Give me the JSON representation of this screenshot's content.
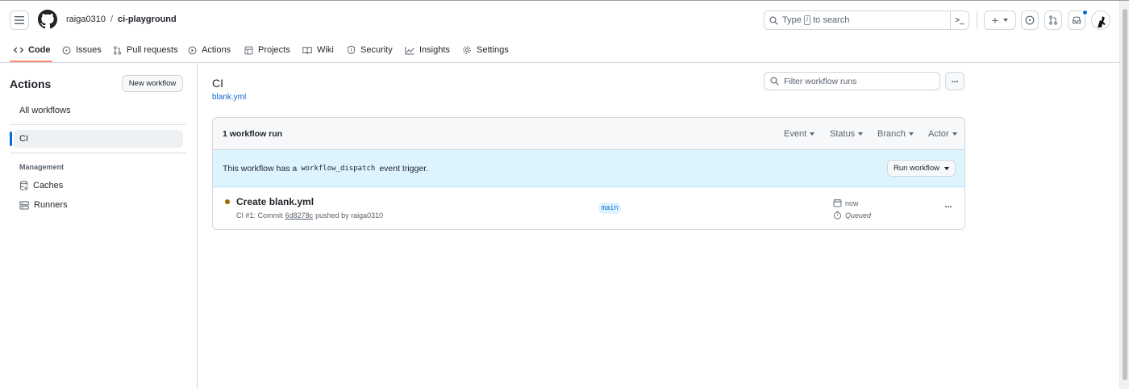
{
  "header": {
    "owner": "raiga0310",
    "separator": "/",
    "repo": "ci-playground",
    "search_text_before": "Type",
    "search_key": "/",
    "search_text_after": "to search",
    "plus_label": "+",
    "terminal_label": ">_"
  },
  "tabs": [
    {
      "label": "Code",
      "icon": "code-icon"
    },
    {
      "label": "Issues",
      "icon": "issue-circle-icon"
    },
    {
      "label": "Pull requests",
      "icon": "pull-request-icon"
    },
    {
      "label": "Actions",
      "icon": "play-circle-icon"
    },
    {
      "label": "Projects",
      "icon": "table-icon"
    },
    {
      "label": "Wiki",
      "icon": "book-icon"
    },
    {
      "label": "Security",
      "icon": "shield-icon"
    },
    {
      "label": "Insights",
      "icon": "graph-icon"
    },
    {
      "label": "Settings",
      "icon": "gear-icon"
    }
  ],
  "sidebar": {
    "title": "Actions",
    "new_workflow": "New workflow",
    "all_workflows": "All workflows",
    "active_workflow": "CI",
    "management_heading": "Management",
    "caches": "Caches",
    "runners": "Runners"
  },
  "main": {
    "workflow_title": "CI",
    "workflow_file": "blank.yml",
    "filter_placeholder": "Filter workflow runs",
    "more_label": "···",
    "run_count": "1 workflow run",
    "filters": [
      "Event",
      "Status",
      "Branch",
      "Actor"
    ],
    "dispatch_before": "This workflow has a",
    "dispatch_code": "workflow_dispatch",
    "dispatch_after": "event trigger.",
    "run_workflow_button": "Run workflow",
    "run": {
      "title": "Create blank.yml",
      "meta_prefix": "CI #1: Commit",
      "commit": "6d8278c",
      "meta_suffix": "pushed by raiga0310",
      "branch": "main",
      "time": "now",
      "status": "Queued",
      "status_color": "#9a6700"
    }
  },
  "colors": {
    "accent": "#0969da",
    "nav_underline": "#fd8c73",
    "notification_dot": "#0969da"
  }
}
